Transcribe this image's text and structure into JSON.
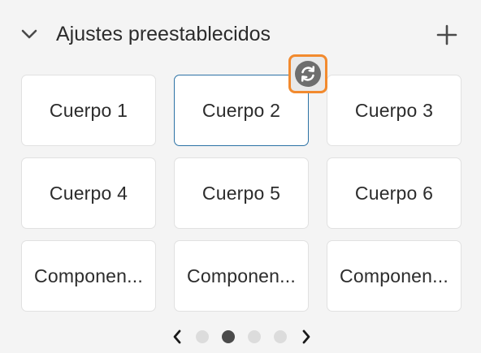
{
  "panel": {
    "title": "Ajustes preestablecidos",
    "collapse_icon": "chevron-down-icon",
    "add_icon": "plus-icon"
  },
  "presets": [
    {
      "label": "Cuerpo 1",
      "selected": false
    },
    {
      "label": "Cuerpo 2",
      "selected": true
    },
    {
      "label": "Cuerpo 3",
      "selected": false
    },
    {
      "label": "Cuerpo 4",
      "selected": false
    },
    {
      "label": "Cuerpo 5",
      "selected": false
    },
    {
      "label": "Cuerpo 6",
      "selected": false
    },
    {
      "label": "Componen...",
      "selected": false
    },
    {
      "label": "Componen...",
      "selected": false
    },
    {
      "label": "Componen...",
      "selected": false
    }
  ],
  "reset_badge": {
    "icon": "refresh-icon",
    "highlight_color": "#f28a2e"
  },
  "pagination": {
    "prev_icon": "chevron-left-icon",
    "next_icon": "chevron-right-icon",
    "pages": 4,
    "current_page": 2
  },
  "colors": {
    "selected_border": "#2c72a5",
    "background": "#f4f4f4"
  }
}
